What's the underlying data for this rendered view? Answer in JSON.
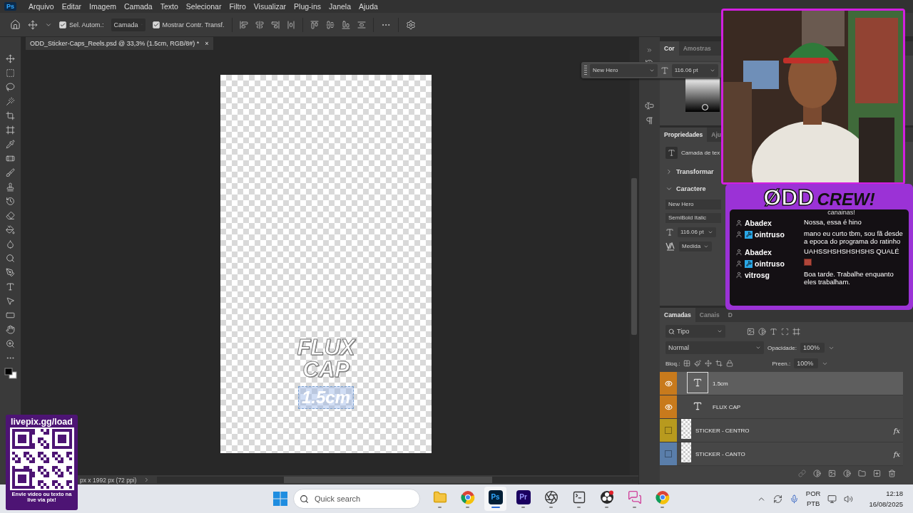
{
  "menu_bar": {
    "app_icon": "Ps",
    "items": [
      "Arquivo",
      "Editar",
      "Imagem",
      "Camada",
      "Texto",
      "Selecionar",
      "Filtro",
      "Visualizar",
      "Plug-ins",
      "Janela",
      "Ajuda"
    ]
  },
  "options_bar": {
    "auto_select": {
      "label": "Sel. Autom.:",
      "checked": true
    },
    "auto_select_target": "Camada",
    "show_transform": {
      "label": "Mostrar Contr. Transf.",
      "checked": true
    }
  },
  "document_tab": {
    "title": "ODD_Sticker-Caps_Reels.psd @ 33,3% (1.5cm, RGB/8#) *",
    "close": "×"
  },
  "canvas": {
    "title_lines": [
      "FLUX",
      "CAP"
    ],
    "editing_text": "1.5cm"
  },
  "status_bar": {
    "document_size": "px x 1992 px (72 ppi)"
  },
  "floating_type_bar": {
    "font": "New Hero",
    "size": "116.06 pt"
  },
  "color_panel": {
    "tabs": [
      {
        "label": "Cor",
        "selected": true
      },
      {
        "label": "Amostras",
        "selected": false
      }
    ]
  },
  "properties_panel": {
    "tabs": [
      {
        "label": "Propriedades",
        "selected": true
      },
      {
        "label": "Aju",
        "selected": false
      }
    ],
    "layer_type": "Camada de tex",
    "sections": [
      {
        "title": "Transformar",
        "expanded": false
      },
      {
        "title": "Caractere",
        "expanded": true
      }
    ],
    "font_family": "New Hero",
    "font_style": "SemiBold Italic",
    "font_size": "116.06 pt",
    "tracking": "Medida"
  },
  "layers_panel": {
    "tabs": [
      {
        "label": "Camadas",
        "selected": true
      },
      {
        "label": "Canais",
        "selected": false
      },
      {
        "label": "D",
        "selected": false
      }
    ],
    "filter": "Tipo",
    "blend_mode": "Normal",
    "opacity_label": "Opacidade:",
    "opacity": "100%",
    "lock_label": "Bloq.:",
    "fill_label": "Preen.:",
    "fill": "100%",
    "layers": [
      {
        "name": "1.5cm",
        "kind": "text",
        "visible": true,
        "selected": true,
        "color": "#c87a1c"
      },
      {
        "name": "FLUX CAP",
        "kind": "text",
        "visible": true,
        "selected": false,
        "color": "#c87a1c"
      },
      {
        "name": "STICKER - CENTRO",
        "kind": "smart",
        "visible": false,
        "selected": false,
        "color": "#b89a1e",
        "effects": "fx"
      },
      {
        "name": "STICKER - CANTO",
        "kind": "smart",
        "visible": false,
        "selected": false,
        "color": "#5a7eaa",
        "effects": "fx"
      }
    ]
  },
  "chat": {
    "logo": [
      "ØDD",
      "CREW!"
    ],
    "overflow_line": "canainas!",
    "messages": [
      {
        "user": "Abadex",
        "badge": false,
        "kind": "text",
        "text": "Nossa, essa é hino"
      },
      {
        "user": "ointruso",
        "badge": true,
        "kind": "text",
        "text": "mano eu curto tbm, sou fã desde a epoca do programa do ratinho"
      },
      {
        "user": "Abadex",
        "badge": false,
        "kind": "text",
        "text": "UAHSSHSHSHSHSHS QUALÉ"
      },
      {
        "user": "ointruso",
        "badge": true,
        "kind": "emote"
      },
      {
        "user": "vitrosg",
        "badge": false,
        "kind": "text",
        "text": "Boa tarde. Trabalhe enquanto eles trabalham."
      }
    ]
  },
  "qr_overlay": {
    "url": "livepix.gg/load",
    "caption": "Envie vídeo ou texto na live via pix!"
  },
  "taskbar": {
    "search_placeholder": "Quick search",
    "apps": [
      {
        "kind": "explorer",
        "selected": false
      },
      {
        "kind": "chrome",
        "selected": false
      },
      {
        "kind": "photoshop",
        "label": "Ps",
        "selected": true
      },
      {
        "kind": "premiere",
        "label": "Pr",
        "selected": false
      },
      {
        "kind": "camera",
        "selected": false
      },
      {
        "kind": "terminal",
        "selected": false
      },
      {
        "kind": "obs",
        "selected": false
      },
      {
        "kind": "chat",
        "selected": false
      },
      {
        "kind": "chrome",
        "selected": false
      }
    ],
    "language": [
      "POR",
      "PTB"
    ],
    "time": "12:18",
    "date": "16/08/2025"
  }
}
